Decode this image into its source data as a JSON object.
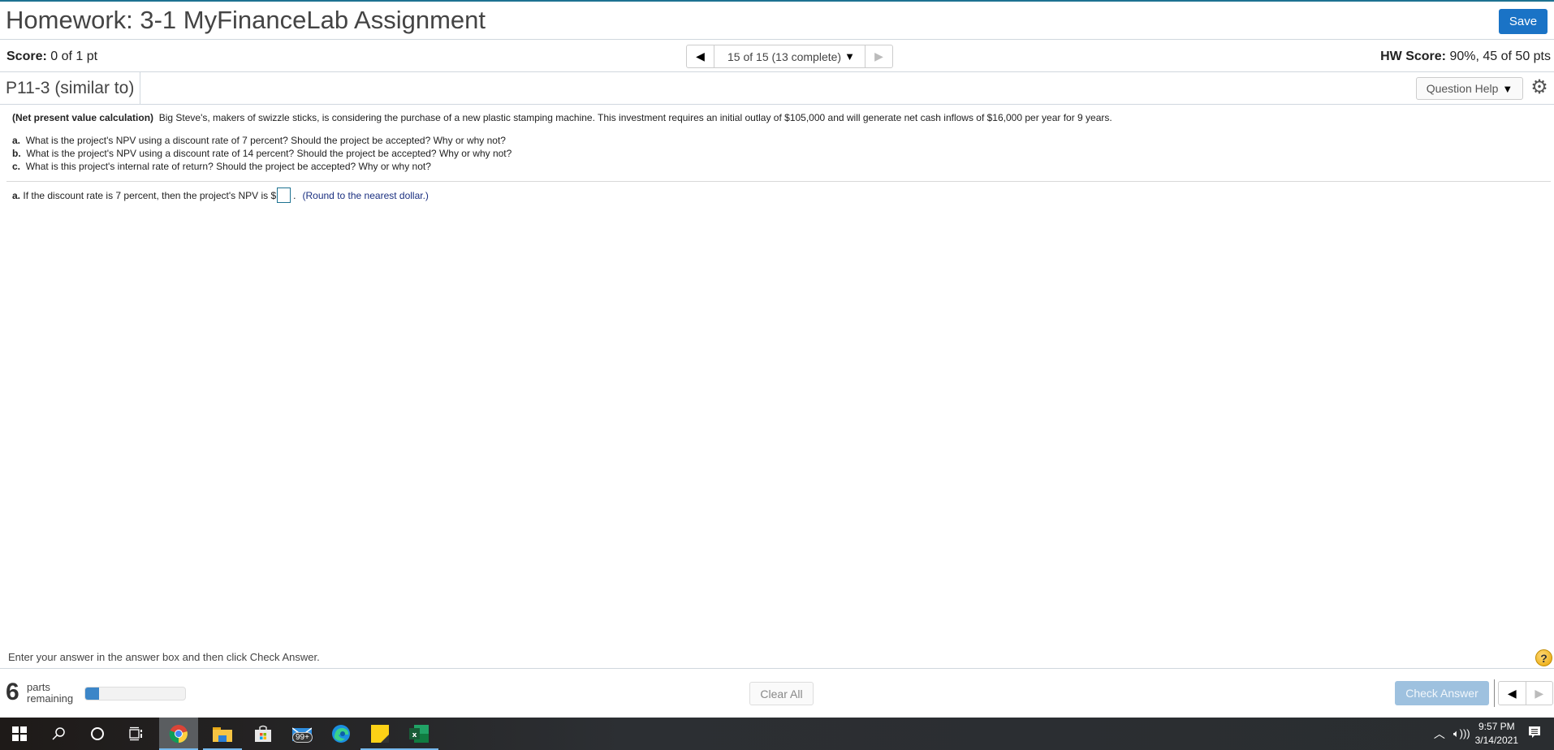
{
  "header": {
    "title": "Homework: 3-1 MyFinanceLab Assignment",
    "save_label": "Save"
  },
  "scorebar": {
    "score_label": "Score:",
    "score_value": "0 of 1 pt",
    "nav_text": "15 of 15 (13 complete)",
    "hw_score_label": "HW Score:",
    "hw_score_value": "90%, 45 of 50 pts"
  },
  "question_bar": {
    "question_id": "P11-3 (similar to)",
    "help_label": "Question Help"
  },
  "question": {
    "topic": "(Net present value calculation)",
    "intro": "Big Steve's, makers of swizzle sticks, is considering the purchase of a new plastic stamping machine.  This investment requires an initial outlay of $105,000 and will generate net cash inflows of $16,000 per year for 9 years.",
    "parts": [
      {
        "letter": "a.",
        "text": "What is the project's NPV using a discount rate of 7 percent?  Should the project be accepted?  Why or why not?"
      },
      {
        "letter": "b.",
        "text": "What is the project's NPV using a discount rate of 14 percent?  Should the project be accepted?  Why or why not?"
      },
      {
        "letter": "c.",
        "text": "What is this project's internal rate of return?  Should the project be accepted?  Why or why not?"
      }
    ]
  },
  "answer": {
    "letter": "a.",
    "prompt": "If the discount rate is 7 percent, then the project's NPV is $",
    "value": "",
    "suffix": ".",
    "hint": "(Round to the nearest dollar.)"
  },
  "footer": {
    "instruction": "Enter your answer in the answer box and then click Check Answer.",
    "parts_remaining": "6",
    "parts_label_1": "parts",
    "parts_label_2": "remaining",
    "progress_percent": 14,
    "clear_all_label": "Clear All",
    "check_answer_label": "Check Answer"
  },
  "taskbar": {
    "icons": [
      "windows-start",
      "search",
      "cortana",
      "task-view",
      "chrome",
      "file-explorer",
      "microsoft-store",
      "mail",
      "edge",
      "sticky-notes",
      "excel"
    ],
    "mail_badge": "99+",
    "time": "9:57 PM",
    "date": "3/14/2021"
  }
}
